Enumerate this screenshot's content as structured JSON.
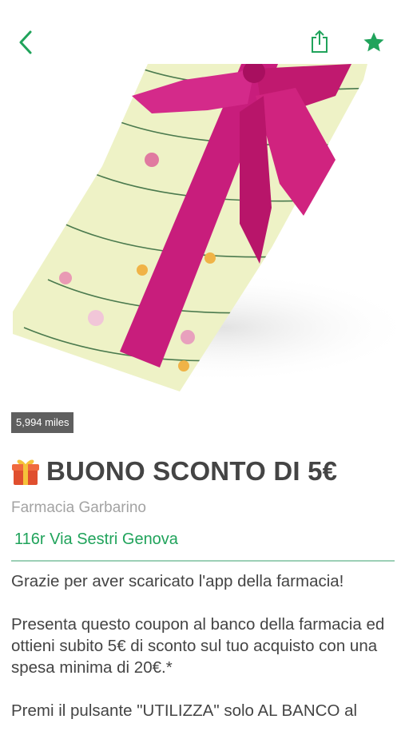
{
  "header": {
    "back_icon": "chevron-left-icon",
    "share_icon": "share-icon",
    "favorite_icon": "star-icon",
    "accent_color": "#20a35b"
  },
  "hero": {
    "image": "gift-box-with-pink-ribbon",
    "distance_label": "5,994 miles"
  },
  "coupon": {
    "icon": "gift-icon",
    "title": "BUONO SCONTO DI 5€",
    "store_name": "Farmacia Garbarino",
    "address": "116r Via Sestri Genova",
    "description": [
      "Grazie per aver scaricato l'app della farmacia!",
      "Presenta questo coupon al banco della farmacia ed ottieni subito 5€ di sconto sul tuo acquisto con una spesa minima di 20€.*",
      "Premi il pulsante \"UTILIZZA\" solo AL BANCO al"
    ]
  }
}
